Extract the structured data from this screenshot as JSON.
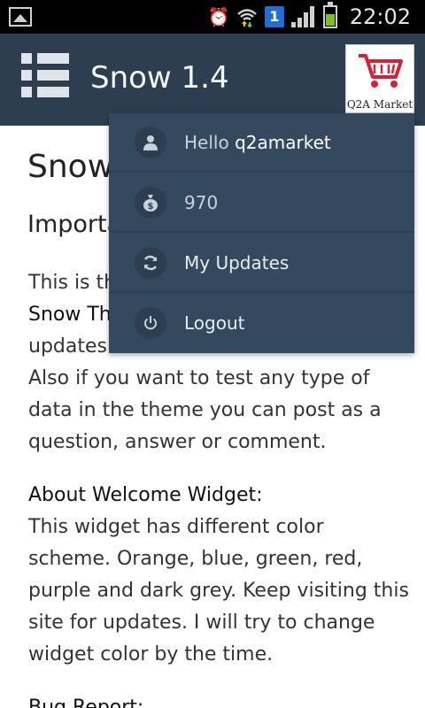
{
  "statusbar": {
    "time": "22:02",
    "badge": "1"
  },
  "topbar": {
    "title": "Snow 1.4",
    "avatar_text": "Q2A Market"
  },
  "content": {
    "page_title": "Snow",
    "section_heading": "Importa",
    "intro_line1_visible": "This is th",
    "intro_bold_visible": "Snow Th",
    "intro_line3_visible": "updates",
    "intro_line4": "Also if you want to test any type of",
    "intro_line5": "data in the theme you can post as a",
    "intro_line6": "question, answer or comment.",
    "welcome_heading": "About Welcome Widget:",
    "welcome_line1": "This widget has different color",
    "welcome_line2": "scheme. Orange, blue, green, red,",
    "welcome_line3": "purple and dark grey. Keep visiting this",
    "welcome_line4": "site for updates. I will try to change",
    "welcome_line5": "widget color by the time.",
    "bug_heading": "Bug Report:"
  },
  "dropdown": {
    "items": [
      {
        "icon": "user-icon",
        "label": "Hello ",
        "username": "q2amarket"
      },
      {
        "icon": "money-bag-icon",
        "label": "970"
      },
      {
        "icon": "refresh-icon",
        "label": "My Updates"
      },
      {
        "icon": "power-icon",
        "label": "Logout"
      }
    ]
  },
  "colors": {
    "header_bg": "#2c3e50",
    "dropdown_bg": "#34495e",
    "accent_text": "#c7d2dc"
  }
}
